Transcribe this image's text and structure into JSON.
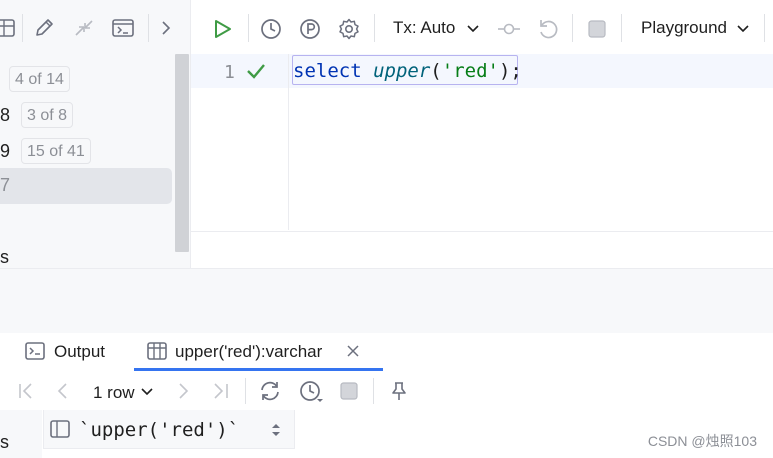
{
  "left_panel": {
    "rows": [
      {
        "num": "",
        "badge": "4 of 14"
      },
      {
        "num": "8",
        "badge": "3 of 8"
      },
      {
        "num": "9",
        "badge": "15 of 41"
      },
      {
        "num": "7",
        "badge": ""
      }
    ],
    "bottom_fragment": "s"
  },
  "editor_toolbar": {
    "tx_mode": "Tx: Auto",
    "session": "Playground"
  },
  "editor": {
    "line_number": "1",
    "code": {
      "keyword": "select",
      "space": " ",
      "function": "upper",
      "open_paren": "(",
      "string": "'red'",
      "close_paren": ")",
      "semicolon": ";"
    }
  },
  "results": {
    "tabs": [
      {
        "label": "Output"
      },
      {
        "label": "upper('red'):varchar"
      }
    ],
    "row_count": "1 row",
    "column_header": "`upper('red')`",
    "row_header_fragment": "s"
  },
  "watermark": "CSDN @烛照103",
  "colors": {
    "accent": "#3574f0",
    "run_green": "#3f9b45",
    "keyword": "#0033b3",
    "function": "#00627a",
    "string": "#067d17"
  }
}
